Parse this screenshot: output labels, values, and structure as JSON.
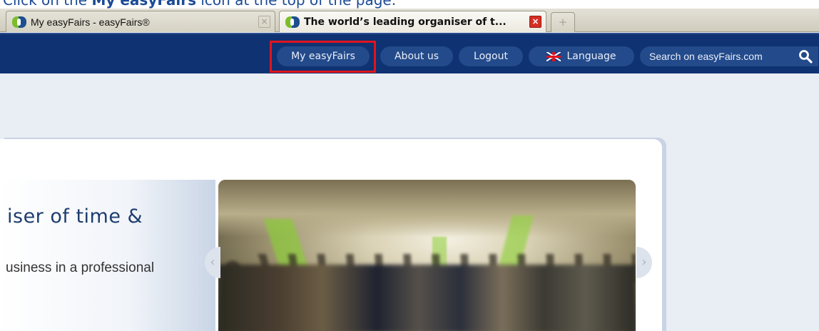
{
  "instruction": {
    "prefix": "Click on the ",
    "emphasis": "My easyFairs",
    "suffix": " icon at the top of the page."
  },
  "browser": {
    "tabs": [
      {
        "title": "My easyFairs - easyFairs®",
        "active": false,
        "close": "×"
      },
      {
        "title": "The world’s leading organiser of t...",
        "active": true,
        "close": "×"
      }
    ],
    "new_tab": "+"
  },
  "nav": {
    "my_easyfairs": "My easyFairs",
    "about_us": "About us",
    "logout": "Logout",
    "language": "Language",
    "search_placeholder": "Search on easyFairs.com",
    "search_icon": "Q"
  },
  "hero": {
    "title": "iser of time &",
    "subtitle": "usiness in a professional",
    "prev_arrow": "‹",
    "next_arrow": "›"
  },
  "colors": {
    "nav_bg": "#0f3272",
    "pill_bg": "#234a8a",
    "highlight": "#e0141c",
    "title_color": "#1d3d6e",
    "brand_green": "#7cbd2a"
  }
}
